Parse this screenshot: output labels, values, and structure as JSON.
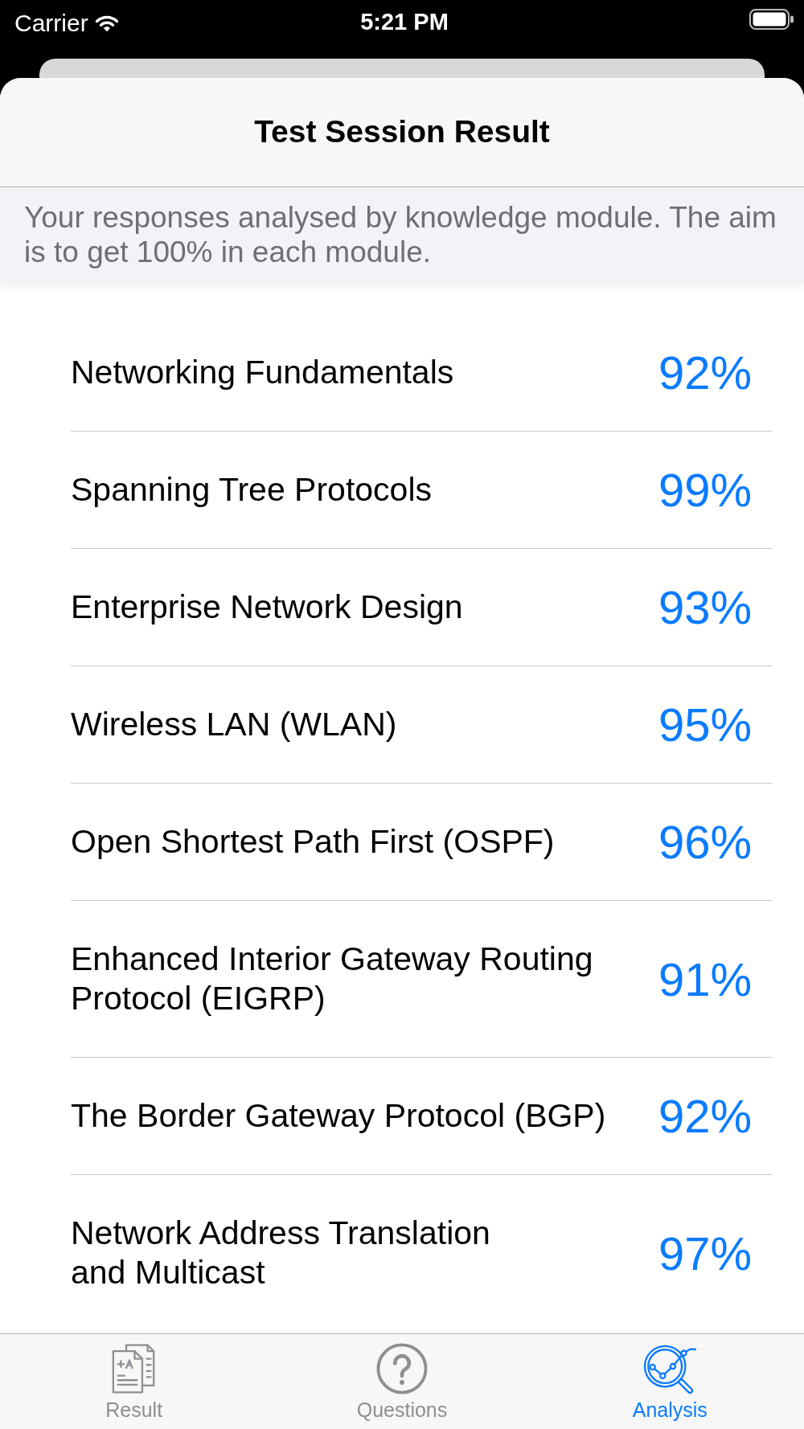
{
  "status_bar": {
    "carrier": "Carrier",
    "time": "5:21 PM"
  },
  "header": {
    "title": "Test Session Result",
    "description": "Your responses analysed by knowledge module. The aim is to get 100% in each module."
  },
  "modules": [
    {
      "name": "Networking Fundamentals",
      "score": "92%"
    },
    {
      "name": "Spanning Tree Protocols",
      "score": "99%"
    },
    {
      "name": "Enterprise Network Design",
      "score": "93%"
    },
    {
      "name": "Wireless LAN (WLAN)",
      "score": "95%"
    },
    {
      "name": "Open Shortest Path First (OSPF)",
      "score": "96%"
    },
    {
      "name": "Enhanced Interior Gateway Routing Protocol (EIGRP)",
      "score": "91%"
    },
    {
      "name": "The Border Gateway Protocol (BGP)",
      "score": "92%"
    },
    {
      "name": "Network Address Translation\nand Multicast",
      "score": "97%"
    }
  ],
  "tab_bar": [
    {
      "kind": "result",
      "label": "Result",
      "selected": false
    },
    {
      "kind": "questions",
      "label": "Questions",
      "selected": false
    },
    {
      "kind": "analysis",
      "label": "Analysis",
      "selected": true
    }
  ]
}
